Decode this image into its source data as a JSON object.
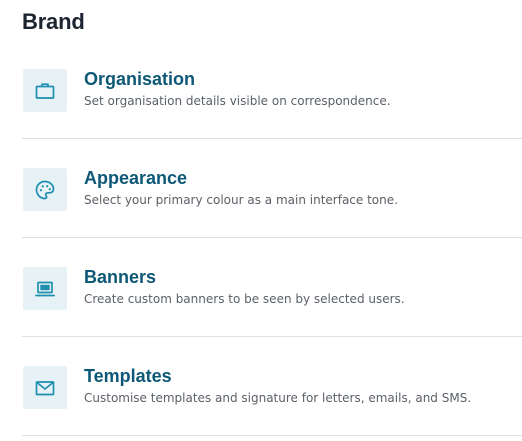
{
  "page": {
    "title": "Brand"
  },
  "items": [
    {
      "title": "Organisation",
      "description": "Set organisation details visible on correspondence.",
      "icon": "briefcase-icon"
    },
    {
      "title": "Appearance",
      "description": "Select your primary colour as a main interface tone.",
      "icon": "palette-icon"
    },
    {
      "title": "Banners",
      "description": "Create custom banners to be seen by selected users.",
      "icon": "laptop-icon"
    },
    {
      "title": "Templates",
      "description": "Customise templates and signature for letters, emails, and SMS.",
      "icon": "envelope-icon"
    }
  ],
  "colors": {
    "accent": "#0e5877",
    "icon": "#1e8fb0",
    "icon_background": "#e7f2f6",
    "divider": "#dde0e3"
  }
}
